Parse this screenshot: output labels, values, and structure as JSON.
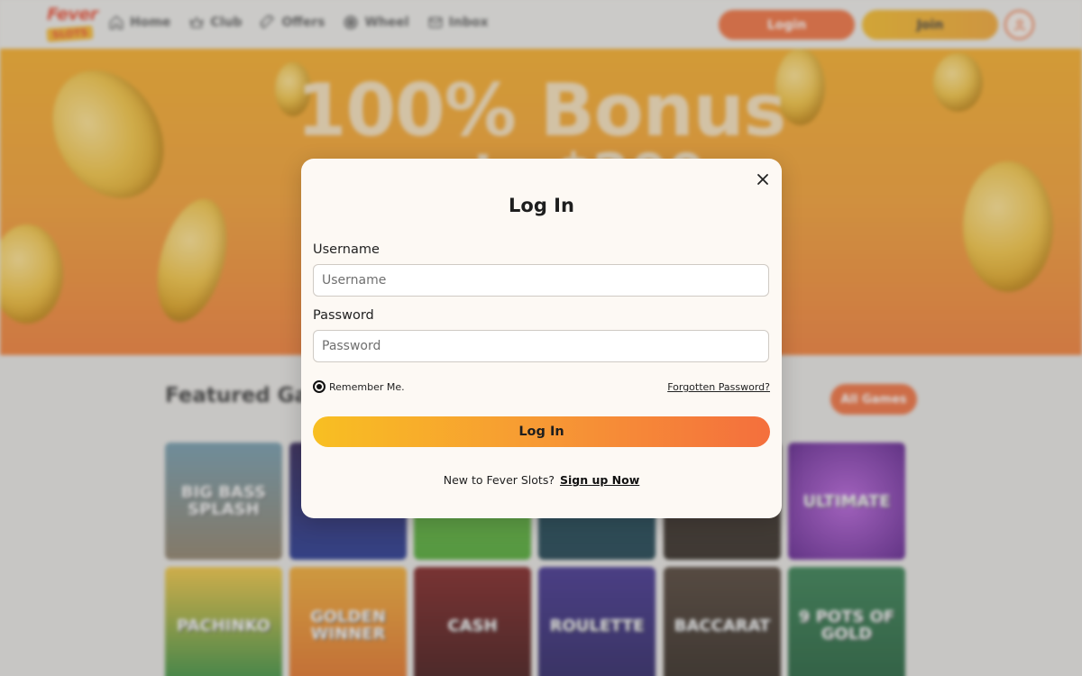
{
  "brand": {
    "logo_top": "Fever",
    "logo_bottom": "SLOTS"
  },
  "nav": {
    "items": [
      {
        "label": "Home",
        "icon": "home-icon"
      },
      {
        "label": "Club",
        "icon": "crown-icon"
      },
      {
        "label": "Offers",
        "icon": "ticket-icon"
      },
      {
        "label": "Wheel",
        "icon": "wheel-icon"
      },
      {
        "label": "Inbox",
        "icon": "mail-icon"
      }
    ],
    "login_label": "Login",
    "join_label": "Join"
  },
  "hero": {
    "title": "100% Bonus",
    "subtitle": "up to $200"
  },
  "featured": {
    "title": "Featured Games",
    "all_games_label": "All Games",
    "row1": [
      "BIG BASS SPLASH",
      "",
      "",
      "",
      "",
      "ULTIMATE"
    ],
    "row2": [
      "PACHINKO",
      "GOLDEN WINNER",
      "CASH",
      "ROULETTE",
      "BACCARAT",
      "9 POTS OF GOLD"
    ]
  },
  "login_modal": {
    "title": "Log In",
    "username_label": "Username",
    "username_placeholder": "Username",
    "password_label": "Password",
    "password_placeholder": "Password",
    "remember_label": "Remember Me.",
    "forgot_label": "Forgotten Password?",
    "submit_label": "Log In",
    "signup_prompt": "New to Fever Slots?",
    "signup_link": "Sign up Now"
  },
  "colors": {
    "accent_orange": "#ef6a36",
    "accent_yellow": "#f4b71f",
    "hero_top": "#f5a91e",
    "modal_bg": "#fdf9f4"
  }
}
